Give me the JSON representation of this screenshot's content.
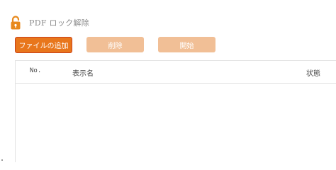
{
  "header": {
    "title": "PDF ロック解除",
    "icon": "lock-open-icon",
    "icon_color": "#e8891c"
  },
  "toolbar": {
    "add_label": "ファイルの追加",
    "delete_label": "削除",
    "start_label": "開始",
    "accent_color": "#e8761c",
    "disabled_color": "#f1bf96"
  },
  "table": {
    "columns": [
      "No.",
      "表示名",
      "状態"
    ],
    "rows": []
  }
}
